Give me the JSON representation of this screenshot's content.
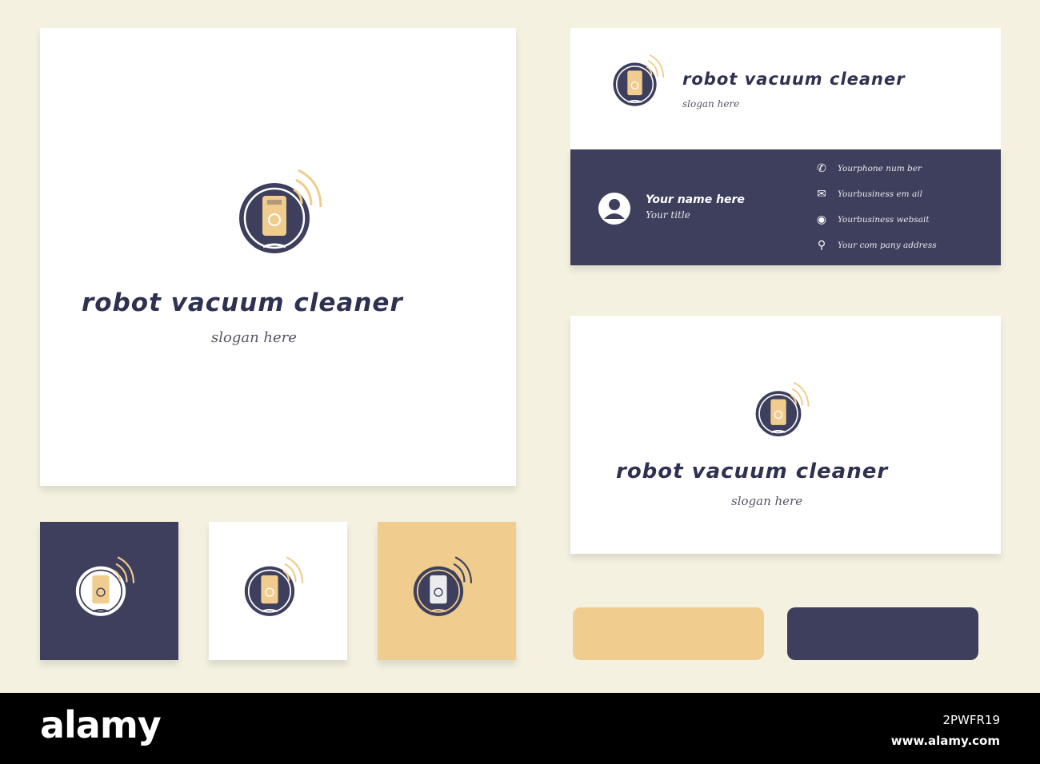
{
  "brand": {
    "name": "robot vacuum cleaner",
    "slogan": "slogan here"
  },
  "business_card": {
    "person_name": "Your name here",
    "person_title": "Your title",
    "contacts": [
      {
        "icon": "phone-icon",
        "text": "Yourphone num ber"
      },
      {
        "icon": "envelope-icon",
        "text": "Yourbusiness em ail"
      },
      {
        "icon": "globe-icon",
        "text": "Yourbusiness websait"
      },
      {
        "icon": "location-pin-icon",
        "text": "Your com pany address"
      }
    ]
  },
  "colors": {
    "navy": "#3d3f5c",
    "gold": "#f0cc8e",
    "background": "#f4f1e1",
    "white": "#ffffff"
  },
  "watermark": {
    "logo": "alamy",
    "image_id": "2PWFR19",
    "url": "www.alamy.com"
  }
}
